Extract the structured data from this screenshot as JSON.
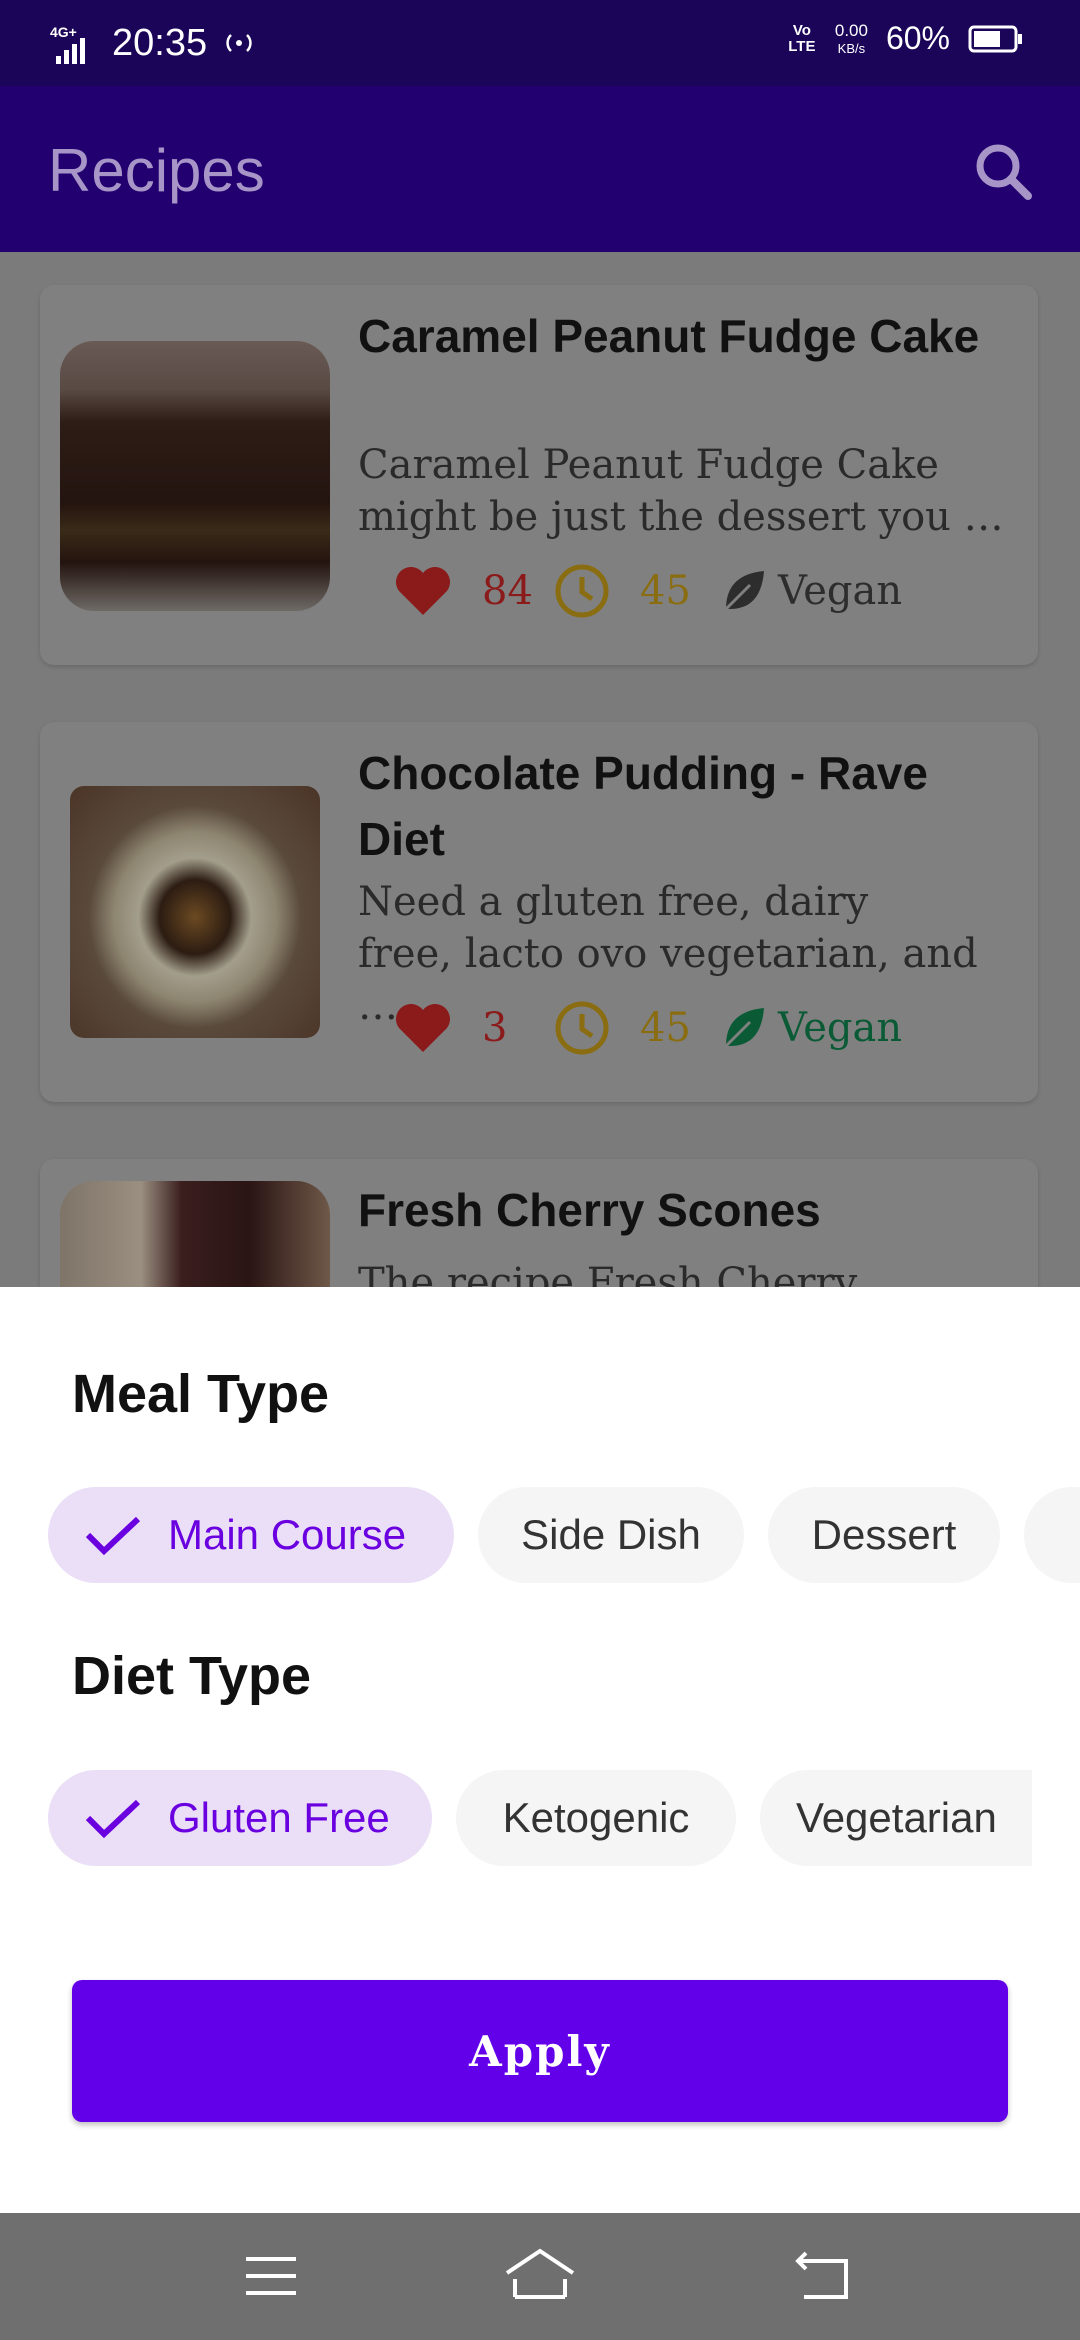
{
  "status_bar": {
    "network": "4G+",
    "time": "20:35",
    "volte": "Vo LTE",
    "speed_value": "0.00",
    "speed_unit": "KB/s",
    "battery": "60%"
  },
  "app_bar": {
    "title": "Recipes",
    "search_icon": "search-icon"
  },
  "recipes": [
    {
      "title": "Caramel Peanut Fudge Cake",
      "description": "Caramel Peanut Fudge Cake\nmight be just the dessert you …",
      "likes": "84",
      "minutes": "45",
      "diet": "Vegan",
      "vegan_active": false
    },
    {
      "title": "Chocolate Pudding - Rave Diet",
      "description": "Need a gluten free, dairy\nfree, lacto ovo vegetarian, and …",
      "likes": "3",
      "minutes": "45",
      "diet": "Vegan",
      "vegan_active": true
    },
    {
      "title": "Fresh Cherry Scones",
      "description": "The recipe Fresh Cherry"
    }
  ],
  "sheet": {
    "meal_type_title": "Meal Type",
    "meal_types": [
      {
        "label": "Main Course",
        "selected": true
      },
      {
        "label": "Side Dish",
        "selected": false
      },
      {
        "label": "Dessert",
        "selected": false
      }
    ],
    "diet_type_title": "Diet Type",
    "diet_types": [
      {
        "label": "Gluten Free",
        "selected": true
      },
      {
        "label": "Ketogenic",
        "selected": false
      },
      {
        "label": "Vegetarian",
        "selected": false
      }
    ],
    "apply_label": "Apply"
  },
  "colors": {
    "accent": "#6200ea",
    "app_bar": "#23006f",
    "chip_selected_bg": "#eadff7"
  }
}
